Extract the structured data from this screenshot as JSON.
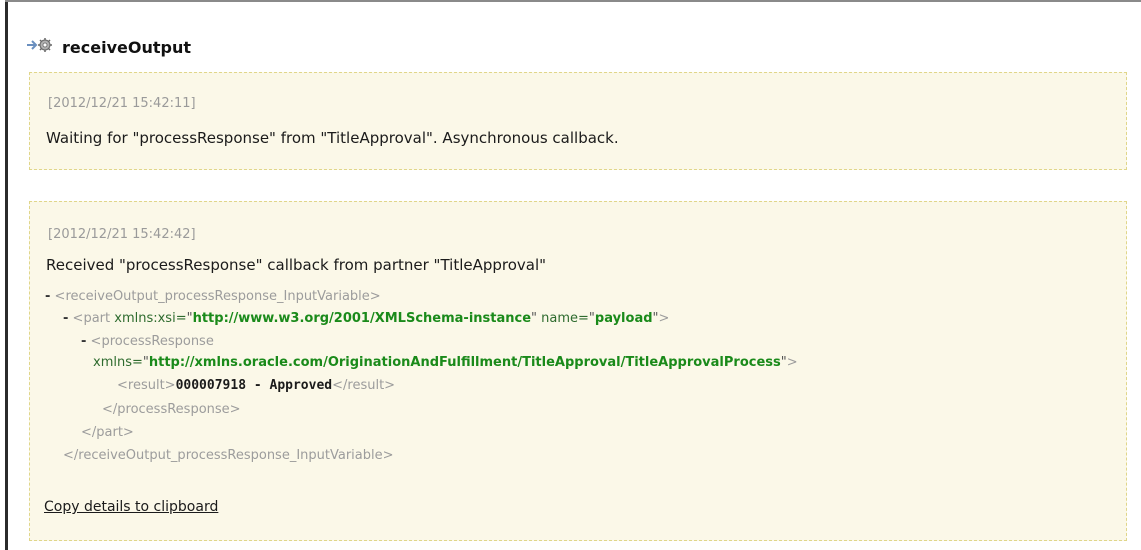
{
  "header": {
    "icon": "activity-gear-icon",
    "title": "receiveOutput"
  },
  "entries": [
    {
      "timestamp": "[2012/12/21 15:42:11]",
      "message": "Waiting for \"processResponse\" from \"TitleApproval\". Asynchronous callback."
    },
    {
      "timestamp": "[2012/12/21 15:42:42]",
      "message": "Received \"processResponse\" callback from partner \"TitleApproval\"",
      "xml": {
        "line1_dash": "-",
        "line1_tag": "<receiveOutput_processResponse_InputVariable>",
        "line2_dash": "-",
        "line2_tag_open": "<part",
        "line2_attr1_name": "xmlns:xsi=",
        "line2_attr1_value": "http://www.w3.org/2001/XMLSchema-instance",
        "line2_attr2_name": "name=",
        "line2_attr2_value": "payload",
        "line2_tag_close": ">",
        "line3_dash": "-",
        "line3_tag": "<processResponse",
        "line4_attr_name": "xmlns=",
        "line4_attr_value": "http://xmlns.oracle.com/OriginationAndFulfillment/TitleApproval/TitleApprovalProcess",
        "line4_tag_close": ">",
        "line5_open": "<result>",
        "line5_value": "000007918 - Approved",
        "line5_close": "</result>",
        "line6_tag": "</processResponse>",
        "line7_tag": "</part>",
        "line8_tag": "</receiveOutput_processResponse_InputVariable>"
      },
      "copy_link": "Copy details to clipboard"
    }
  ],
  "colors": {
    "panel_bg": "#fbf8e8",
    "panel_border": "#e0d68a",
    "xml_value_green": "#1a8a1a",
    "xml_tag_gray": "#9c9c9c"
  }
}
